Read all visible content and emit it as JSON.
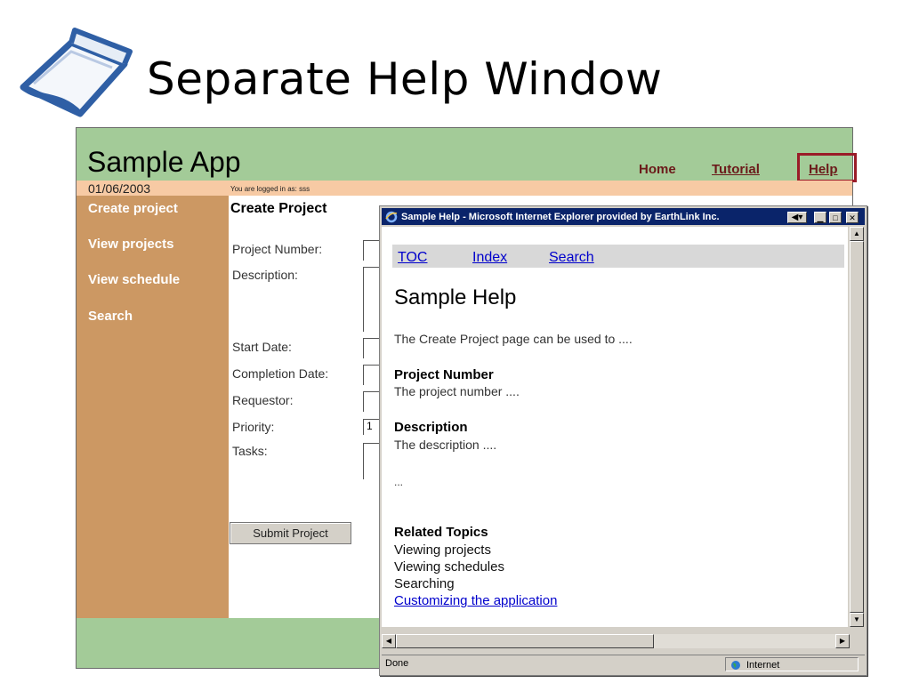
{
  "slide": {
    "title": "Separate Help Window",
    "logo_icon": "paper-cube-logo"
  },
  "app": {
    "title": "Sample App",
    "nav": {
      "home": "Home",
      "tutorial": "Tutorial",
      "help": "Help"
    },
    "date": "01/06/2003",
    "logged_in": "You are logged in as: sss",
    "sidebar": [
      "Create project",
      "View projects",
      "View schedule",
      "Search"
    ],
    "form": {
      "title": "Create Project",
      "labels": {
        "project_number": "Project Number:",
        "description": "Description:",
        "start_date": "Start Date:",
        "completion_date": "Completion Date:",
        "requestor": "Requestor:",
        "priority": "Priority:",
        "tasks": "Tasks:"
      },
      "priority_value": "1",
      "submit": "Submit Project"
    },
    "colors": {
      "background": "#a3cb98",
      "sidebar": "#cc9863",
      "status_strip": "#f7caa4",
      "highlight": "#9a1c28"
    }
  },
  "help_window": {
    "title": "Sample Help - Microsoft Internet Explorer provided by EarthLink Inc.",
    "nav": {
      "toc": "TOC",
      "index": "Index",
      "search": "Search"
    },
    "heading": "Sample Help",
    "intro": "The Create Project page can be used to ....",
    "sections": [
      {
        "heading": "Project Number",
        "text": "The project number ...."
      },
      {
        "heading": "Description",
        "text": "The description ...."
      }
    ],
    "ellipsis": "...",
    "related": {
      "heading": "Related Topics",
      "items": [
        "Viewing projects",
        "Viewing schedules",
        "Searching"
      ],
      "link": "Customizing the application"
    },
    "status": {
      "done": "Done",
      "zone": "Internet"
    }
  }
}
